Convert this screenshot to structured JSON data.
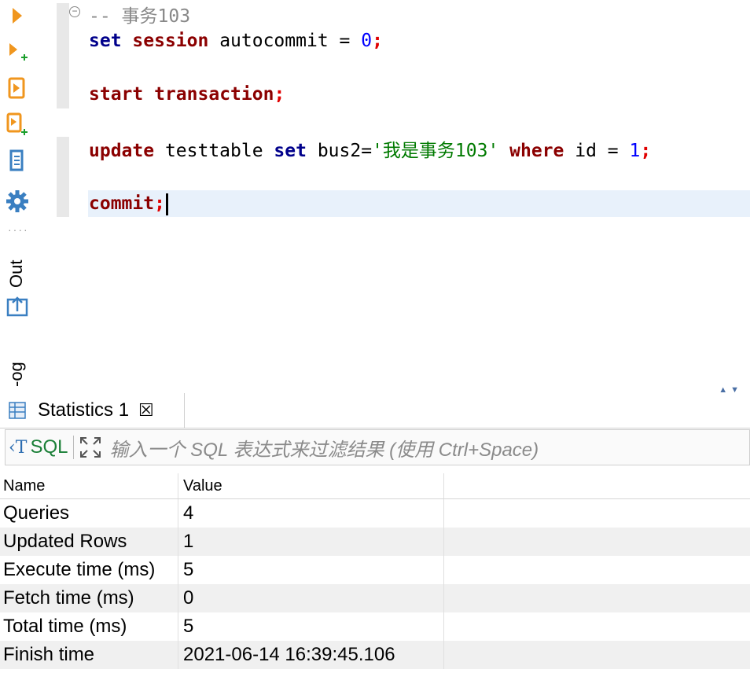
{
  "toolbar": {
    "items": [
      {
        "icon": "execute-statement-icon"
      },
      {
        "icon": "execute-statement-new-tab-icon"
      },
      {
        "icon": "execute-script-icon"
      },
      {
        "icon": "execute-script-new-tab-icon"
      },
      {
        "icon": "explain-plan-icon"
      },
      {
        "icon": "settings-icon"
      }
    ],
    "out_label": "Out",
    "log_label": "-og"
  },
  "editor": {
    "comment": "-- 事务103",
    "line1": {
      "kw1": "set",
      "kw2": "session",
      "ident": " autocommit = ",
      "num": "0",
      "end": ";"
    },
    "line2": {
      "kw1": "start",
      "kw2": "transaction",
      "end": ";"
    },
    "line3": {
      "kw1": "update",
      "ident1": " testtable ",
      "kw2": "set",
      "ident2": " bus2=",
      "str": "'我是事务103'",
      "kw3": "where",
      "ident3": " id = ",
      "num": "1",
      "end": ";"
    },
    "line4": {
      "kw1": "commit",
      "end": ";"
    }
  },
  "panel": {
    "tab_label": "Statistics 1",
    "filter": {
      "sql_label": "SQL",
      "placeholder_main": "输入一个 SQL 表达式来过滤结果 (使用 Ctrl+Space)"
    },
    "columns": [
      "Name",
      "Value"
    ],
    "rows": [
      {
        "name": "Queries",
        "value": "4"
      },
      {
        "name": "Updated Rows",
        "value": "1"
      },
      {
        "name": "Execute time (ms)",
        "value": "5"
      },
      {
        "name": "Fetch time (ms)",
        "value": "0"
      },
      {
        "name": "Total time (ms)",
        "value": "5"
      },
      {
        "name": "Finish time",
        "value": "2021-06-14 16:39:45.106"
      }
    ]
  },
  "colors": {
    "accent_orange": "#f0961e",
    "accent_blue": "#3a7fc1",
    "keyword_blue": "#00008b",
    "keyword_red": "#8b0000",
    "string_green": "#007a00"
  }
}
